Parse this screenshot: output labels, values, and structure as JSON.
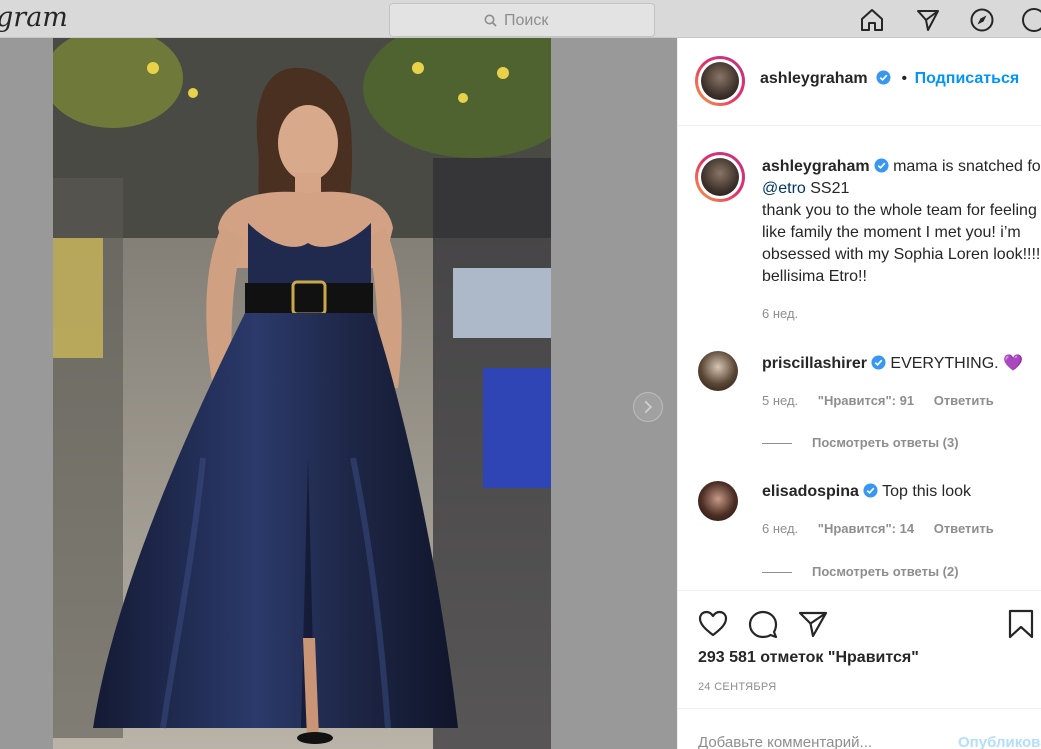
{
  "nav": {
    "logo": "gram",
    "search_placeholder": "Поиск",
    "icons": [
      "home-icon",
      "direct-icon",
      "explore-icon",
      "profile-icon"
    ]
  },
  "post": {
    "author": "ashleygraham",
    "follow_label": "Подписаться",
    "caption": {
      "username": "ashleygraham",
      "text_before_mention": "mama is snatched for ",
      "mention": "@etro",
      "text_after_mention": " SS21",
      "body": "thank you to the whole team for feeling like family the moment I met you! i’m obsessed with my Sophia Loren look!!!!! bellisima Etro!!",
      "time": "6 нед."
    },
    "comments": [
      {
        "username": "priscillashirer",
        "text": "EVERYTHING.",
        "emoji": "💜",
        "time": "5 нед.",
        "likes": "\"Нравится\": 91",
        "reply": "Ответить",
        "view_replies": "Посмотреть ответы (3)"
      },
      {
        "username": "elisadospina",
        "text": "Top this look",
        "time": "6 нед.",
        "likes": "\"Нравится\": 14",
        "reply": "Ответить",
        "view_replies": "Посмотреть ответы (2)"
      }
    ],
    "likes_count": "293 581",
    "likes_label": " отметок \"Нравится\"",
    "date": "24 СЕНТЯБРЯ",
    "comment_placeholder": "Добавьте комментарий...",
    "publish_label": "Опубликовать"
  },
  "colors": {
    "accent": "#0095f6",
    "verified": "#3897f0",
    "dress": "#1e2747",
    "muted": "#8e8e8e"
  }
}
